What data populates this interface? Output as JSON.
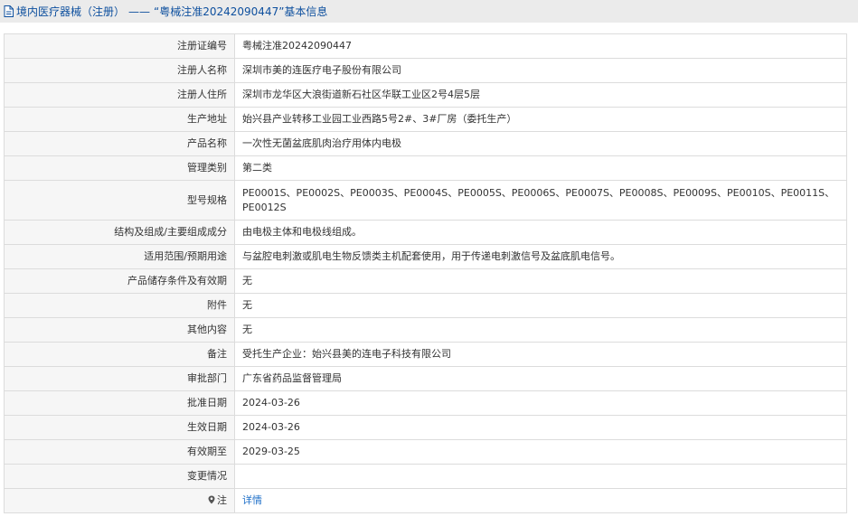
{
  "header": {
    "breadcrumb_category": "境内医疗器械（注册）",
    "separator": "——",
    "title": "“粤械注准20242090447”基本信息"
  },
  "rows": [
    {
      "label": "注册证编号",
      "value": "粤械注准20242090447"
    },
    {
      "label": "注册人名称",
      "value": "深圳市美的连医疗电子股份有限公司"
    },
    {
      "label": "注册人住所",
      "value": "深圳市龙华区大浪街道新石社区华联工业区2号4层5层"
    },
    {
      "label": "生产地址",
      "value": "始兴县产业转移工业园工业西路5号2#、3#厂房（委托生产）"
    },
    {
      "label": "产品名称",
      "value": "一次性无菌盆底肌肉治疗用体内电极"
    },
    {
      "label": "管理类别",
      "value": "第二类"
    },
    {
      "label": "型号规格",
      "value": "PE0001S、PE0002S、PE0003S、PE0004S、PE0005S、PE0006S、PE0007S、PE0008S、PE0009S、PE0010S、PE0011S、PE0012S"
    },
    {
      "label": "结构及组成/主要组成成分",
      "value": "由电极主体和电极线组成。"
    },
    {
      "label": "适用范围/预期用途",
      "value": "与盆腔电刺激或肌电生物反馈类主机配套使用，用于传递电刺激信号及盆底肌电信号。"
    },
    {
      "label": "产品储存条件及有效期",
      "value": "无"
    },
    {
      "label": "附件",
      "value": "无"
    },
    {
      "label": "其他内容",
      "value": "无"
    },
    {
      "label": "备注",
      "value": "受托生产企业：始兴县美的连电子科技有限公司"
    },
    {
      "label": "审批部门",
      "value": "广东省药品监督管理局"
    },
    {
      "label": "批准日期",
      "value": "2024-03-26"
    },
    {
      "label": "生效日期",
      "value": "2024-03-26"
    },
    {
      "label": "有效期至",
      "value": "2029-03-25"
    },
    {
      "label": "变更情况",
      "value": ""
    }
  ],
  "note_row": {
    "label": "注",
    "link_text": "详情",
    "icon": "map-pin-icon"
  },
  "colors": {
    "header_bg": "#ebebeb",
    "title": "#0d4f9e",
    "label_bg": "#f6f6f6",
    "border": "#dcdcdc",
    "link": "#1e6fc8"
  }
}
